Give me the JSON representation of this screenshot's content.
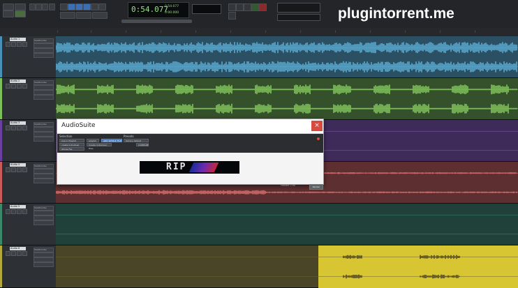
{
  "watermark": "plugintorrent.me",
  "transport": {
    "main_counter": "0:54.077",
    "sub_counter_1": "0:54.077",
    "sub_counter_2": "0:00.000"
  },
  "tracks": [
    {
      "name": "Audio 1",
      "color": "#4a8fb8",
      "lane": "#2b4f63",
      "wave": "#5aa9d0",
      "plugin": "ShelfLimiter"
    },
    {
      "name": "Audio 2",
      "color": "#7bc05a",
      "lane": "#35512b",
      "wave": "#82c35d",
      "plugin": "ShelfLimiter"
    },
    {
      "name": "Audio 3",
      "color": "#6b3fa0",
      "lane": "#3f2b5a",
      "wave": "#8b5fc0",
      "plugin": "ShelfLimiter"
    },
    {
      "name": "Audio 4",
      "color": "#c85a5a",
      "lane": "#5e2f30",
      "wave": "#d66b6b",
      "plugin": "ShelfLimiter"
    },
    {
      "name": "Audio 5",
      "color": "#3a8a6a",
      "lane": "#20413a",
      "wave": "#3a8a6a",
      "plugin": "ShelfLimiter"
    },
    {
      "name": "Audio 6",
      "color": "#b5a83a",
      "lane": "#4a4527",
      "wave": "#d7c531",
      "plugin": "ShelfLimiter"
    }
  ],
  "audiosuite": {
    "title": "AudioSuite",
    "close": "×",
    "section_left": "Selection",
    "section_right": "Presets",
    "field_1": "Use in Playlist",
    "field_2": "playlist",
    "field_3": "create individual files",
    "field_4": "Create Individual Files",
    "field_5": "Whole File",
    "blue_btn": "ADD WHOLE FILE",
    "preset": "factory default",
    "compare": "COMPARE",
    "handle_text": "Whole File",
    "render_label": "Render",
    "status_text": "Handle 2.00"
  }
}
